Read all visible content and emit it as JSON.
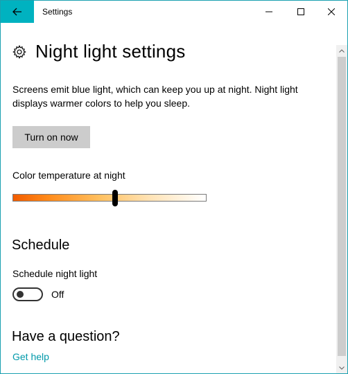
{
  "window": {
    "title": "Settings"
  },
  "page": {
    "title": "Night light settings",
    "description": "Screens emit blue light, which can keep you up at night. Night light displays warmer colors to help you sleep.",
    "turn_on_label": "Turn on now"
  },
  "color_temperature": {
    "label": "Color temperature at night",
    "value_fraction": 0.53,
    "gradient": [
      "#f25c00",
      "#ffc060",
      "#ffffff"
    ]
  },
  "schedule": {
    "heading": "Schedule",
    "toggle_label": "Schedule night light",
    "toggle_state": "Off"
  },
  "help": {
    "heading": "Have a question?",
    "link": "Get help"
  },
  "colors": {
    "accent": "#00b2c0",
    "link": "#0099aa",
    "button": "#cccccc"
  },
  "icons": {
    "back": "back-arrow-icon",
    "settings": "gear-icon"
  }
}
